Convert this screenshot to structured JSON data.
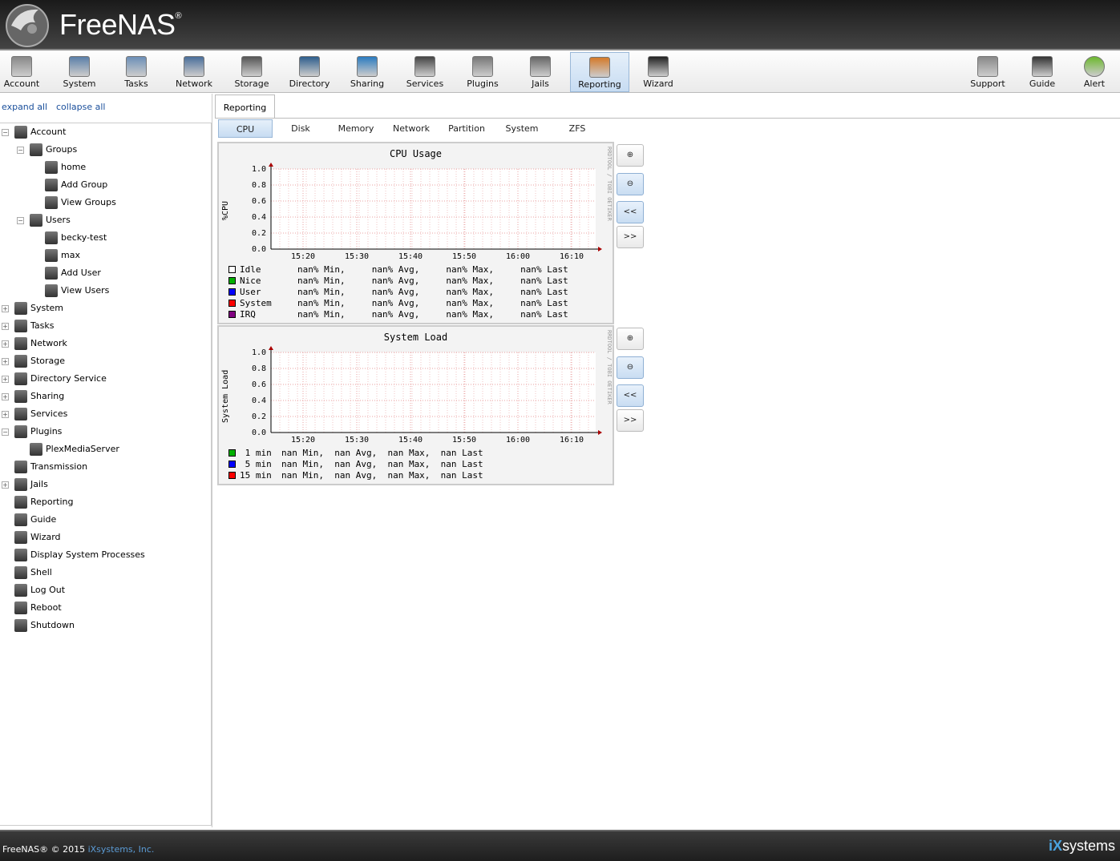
{
  "brand": {
    "name": "FreeNAS",
    "mark": "®"
  },
  "toolbar": {
    "items": [
      {
        "label": "Account",
        "icon": "users-icon"
      },
      {
        "label": "System",
        "icon": "system-icon"
      },
      {
        "label": "Tasks",
        "icon": "tasks-icon"
      },
      {
        "label": "Network",
        "icon": "network-icon"
      },
      {
        "label": "Storage",
        "icon": "storage-icon"
      },
      {
        "label": "Directory",
        "icon": "directory-icon"
      },
      {
        "label": "Sharing",
        "icon": "sharing-icon"
      },
      {
        "label": "Services",
        "icon": "services-icon"
      },
      {
        "label": "Plugins",
        "icon": "plugins-icon"
      },
      {
        "label": "Jails",
        "icon": "jails-icon"
      },
      {
        "label": "Reporting",
        "icon": "reporting-icon"
      },
      {
        "label": "Wizard",
        "icon": "wizard-icon"
      },
      {
        "label": "Support",
        "icon": "support-icon"
      },
      {
        "label": "Guide",
        "icon": "guide-icon"
      },
      {
        "label": "Alert",
        "icon": "alert-icon"
      }
    ],
    "active": "Reporting"
  },
  "sidebar": {
    "expand_all": "expand all",
    "collapse_all": "collapse all",
    "tree": [
      {
        "label": "Account",
        "toggle": "−"
      },
      {
        "label": "Groups",
        "toggle": "−"
      },
      {
        "label": "home"
      },
      {
        "label": "Add Group"
      },
      {
        "label": "View Groups"
      },
      {
        "label": "Users",
        "toggle": "−"
      },
      {
        "label": "becky-test"
      },
      {
        "label": "max"
      },
      {
        "label": "Add User"
      },
      {
        "label": "View Users"
      },
      {
        "label": "System",
        "toggle": "+"
      },
      {
        "label": "Tasks",
        "toggle": "+"
      },
      {
        "label": "Network",
        "toggle": "+"
      },
      {
        "label": "Storage",
        "toggle": "+"
      },
      {
        "label": "Directory Service",
        "toggle": "+"
      },
      {
        "label": "Sharing",
        "toggle": "+"
      },
      {
        "label": "Services",
        "toggle": "+"
      },
      {
        "label": "Plugins",
        "toggle": "−"
      },
      {
        "label": "PlexMediaServer"
      },
      {
        "label": "Transmission"
      },
      {
        "label": "Jails",
        "toggle": "+"
      },
      {
        "label": "Reporting"
      },
      {
        "label": "Guide"
      },
      {
        "label": "Wizard"
      },
      {
        "label": "Display System Processes"
      },
      {
        "label": "Shell"
      },
      {
        "label": "Log Out"
      },
      {
        "label": "Reboot"
      },
      {
        "label": "Shutdown"
      }
    ]
  },
  "main": {
    "tab": "Reporting",
    "subtabs": [
      "CPU",
      "Disk",
      "Memory",
      "Network",
      "Partition",
      "System",
      "ZFS"
    ],
    "active_subtab": "CPU",
    "zoom": {
      "in": "🔍+",
      "out": "🔍−",
      "back": "<<",
      "forward": ">>"
    }
  },
  "graphs": {
    "credit": "RRDTOOL / TOBI OETIKER",
    "cpu": {
      "title": "CPU Usage",
      "ylabel": "%CPU",
      "legend": [
        {
          "name": "Idle",
          "color": "#ffffff",
          "stats": "nan% Min,     nan% Avg,     nan% Max,     nan% Last"
        },
        {
          "name": "Nice",
          "color": "#00b000",
          "stats": "nan% Min,     nan% Avg,     nan% Max,     nan% Last"
        },
        {
          "name": "User",
          "color": "#0000ff",
          "stats": "nan% Min,     nan% Avg,     nan% Max,     nan% Last"
        },
        {
          "name": "System",
          "color": "#ff0000",
          "stats": "nan% Min,     nan% Avg,     nan% Max,     nan% Last"
        },
        {
          "name": "IRQ",
          "color": "#800080",
          "stats": "nan% Min,     nan% Avg,     nan% Max,     nan% Last"
        }
      ]
    },
    "load": {
      "title": "System Load",
      "ylabel": "System Load",
      "legend": [
        {
          "name": " 1 min",
          "color": "#00b000",
          "stats": "nan Min,  nan Avg,  nan Max,  nan Last"
        },
        {
          "name": " 5 min",
          "color": "#0000ff",
          "stats": "nan Min,  nan Avg,  nan Max,  nan Last"
        },
        {
          "name": "15 min",
          "color": "#ff0000",
          "stats": "nan Min,  nan Avg,  nan Max,  nan Last"
        }
      ]
    }
  },
  "chart_data": [
    {
      "type": "line",
      "title": "CPU Usage",
      "ylabel": "%CPU",
      "xlabel": "",
      "x": [
        "15:20",
        "15:30",
        "15:40",
        "15:50",
        "16:00",
        "16:10"
      ],
      "yticks": [
        "0.0",
        "0.2",
        "0.4",
        "0.6",
        "0.8",
        "1.0"
      ],
      "ylim": [
        0,
        1
      ],
      "series": [],
      "grid": true
    },
    {
      "type": "line",
      "title": "System Load",
      "ylabel": "System Load",
      "xlabel": "",
      "x": [
        "15:20",
        "15:30",
        "15:40",
        "15:50",
        "16:00",
        "16:10"
      ],
      "yticks": [
        "0.0",
        "0.2",
        "0.4",
        "0.6",
        "0.8",
        "1.0"
      ],
      "ylim": [
        0,
        1
      ],
      "series": [],
      "grid": true
    }
  ],
  "footer": {
    "copyright": "FreeNAS® © 2015 ",
    "company": "iXsystems, Inc.",
    "logo_ix": "iX",
    "logo_systems": "systems"
  }
}
